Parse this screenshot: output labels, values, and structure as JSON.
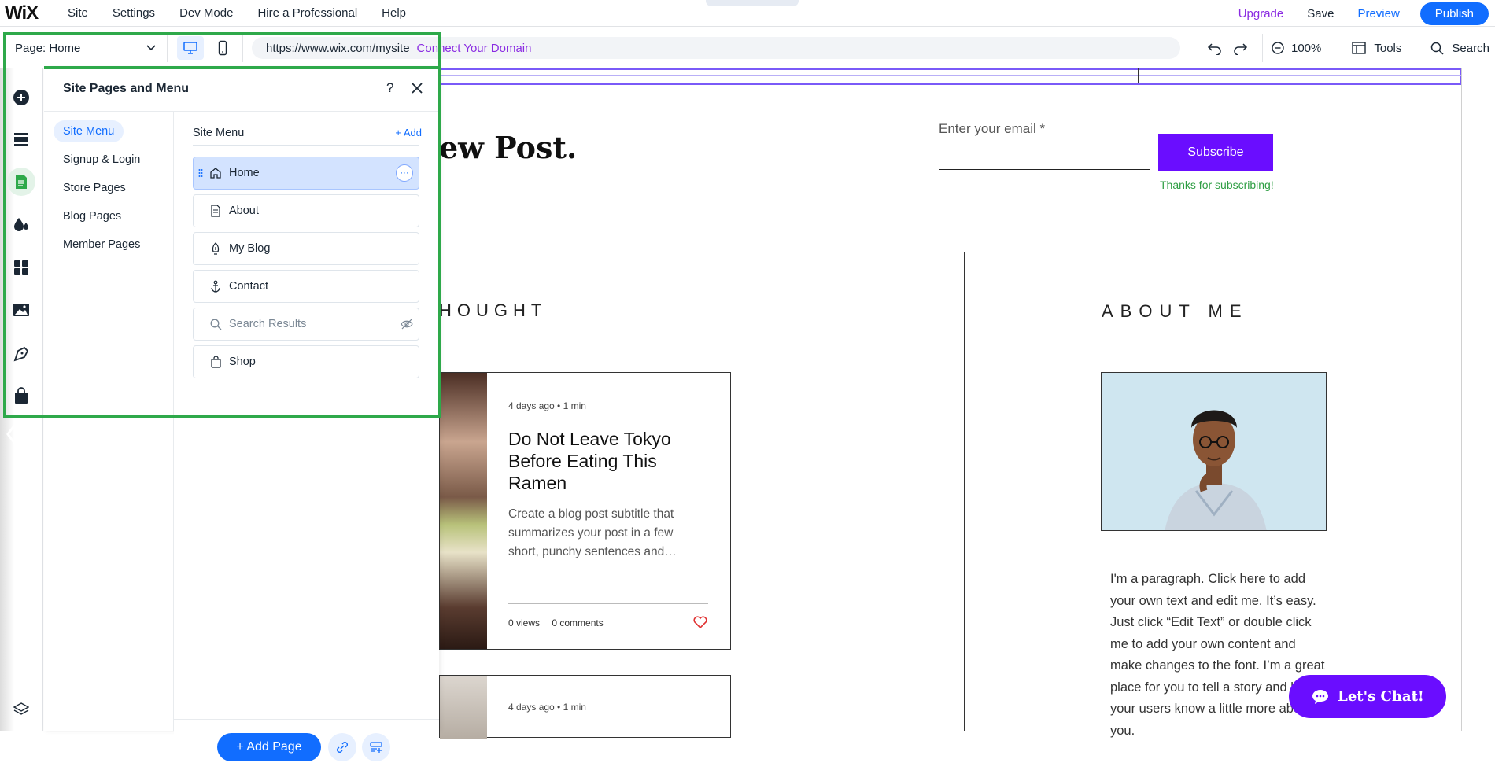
{
  "topbar": {
    "logo": "WiX",
    "menu": [
      "Site",
      "Settings",
      "Dev Mode",
      "Hire a Professional",
      "Help"
    ],
    "upgrade": "Upgrade",
    "save": "Save",
    "preview": "Preview",
    "publish": "Publish"
  },
  "toolbar": {
    "page_prefix": "Page:",
    "page_name": "Home",
    "url": "https://www.wix.com/mysite",
    "connect_domain": "Connect Your Domain",
    "zoom": "100%",
    "tools": "Tools",
    "search": "Search"
  },
  "panel": {
    "title": "Site Pages and Menu",
    "help": "?",
    "categories": [
      "Site Menu",
      "Signup & Login",
      "Store Pages",
      "Blog Pages",
      "Member Pages"
    ],
    "menu_title": "Site Menu",
    "add": "+ Add",
    "pages": [
      {
        "label": "Home",
        "icon": "home-icon"
      },
      {
        "label": "About",
        "icon": "page-icon"
      },
      {
        "label": "My Blog",
        "icon": "pen-nib-icon"
      },
      {
        "label": "Contact",
        "icon": "anchor-icon"
      },
      {
        "label": "Search Results",
        "icon": "search-icon"
      },
      {
        "label": "Shop",
        "icon": "bag-icon"
      }
    ],
    "add_page": "+ Add Page"
  },
  "canvas": {
    "headline_fragment": "ew Post.",
    "email_label": "Enter your email *",
    "subscribe": "Subscribe",
    "thanks": "Thanks for subscribing!",
    "section_left": "HOUGHT",
    "section_right": "ABOUT ME",
    "post": {
      "meta": "4 days ago  •  1 min",
      "title": "Do Not Leave Tokyo Before Eating This Ramen",
      "subtitle": "Create a blog post subtitle that summarizes your post in a few short, punchy sentences and…",
      "views": "0 views",
      "comments": "0 comments"
    },
    "post2_meta": "4 days ago  •  1 min",
    "about_text": "I'm a paragraph. Click here to add your own text and edit me. It’s easy. Just click “Edit Text” or double click me to add your own content and make changes to the font. I’m a great place for you to tell a story and let your users know a little more about you.",
    "chat": "Let's Chat!"
  },
  "colors": {
    "accent": "#116dff",
    "upgrade": "#8a2be2",
    "brand_purple": "#6a0dff",
    "highlight": "#2ea94a"
  }
}
